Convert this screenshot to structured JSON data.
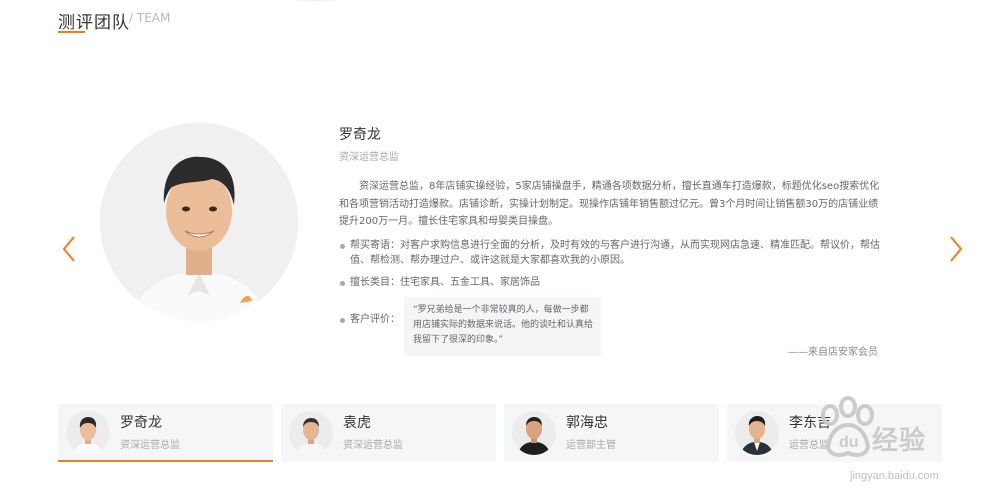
{
  "section": {
    "title": "测评团队",
    "subtitle": "/ TEAM"
  },
  "profile": {
    "name": "罗奇龙",
    "role": "资深运营总监",
    "description": "资深运营总监，8年店铺实操经验，5家店铺操盘手，精通各项数据分析，擅长直通车打造爆款，标题优化seo搜索优化和各项营销活动打造爆款。店铺诊断，实操计划制定。现操作店铺年销售额过亿元。曾3个月时间让销售额30万的店铺业绩提升200万一月。擅长住宅家具和母婴类目操盘。",
    "bullets": {
      "help": "帮买寄语：对客户求购信息进行全面的分析，及时有效的与客户进行沟通，从而实现网店急速、精准匹配。帮议价，帮估值、帮检测、帮办理过户、或许这就是大家都喜欢我的小原因。",
      "category": "擅长类目：住宅家具、五金工具、家居饰品",
      "review_label": "客户评价："
    },
    "quote": "“罗兄弟给是一个非常较真的人，每做一步都用店铺实际的数据来说话。他的谈吐和认真给我留下了很深的印象。”",
    "quote_source": "——来自店安家会员"
  },
  "team": [
    {
      "name": "罗奇龙",
      "role": "资深运营总监",
      "active": true
    },
    {
      "name": "袁虎",
      "role": "资深运营总监",
      "active": false
    },
    {
      "name": "郭海忠",
      "role": "运营部主管",
      "active": false
    },
    {
      "name": "李东吉",
      "role": "运营总监",
      "active": false
    }
  ],
  "watermark": {
    "text": "经验",
    "url": "jingyan.baidu.com"
  },
  "colors": {
    "accent": "#f07c1e",
    "card_bg": "#f5f6f8",
    "quote_bg": "#f4f5f7",
    "muted_text": "#a8a8a8"
  },
  "icons": {
    "prev": "chevron-left-icon",
    "next": "chevron-right-icon",
    "watermark": "baidu-paw-icon"
  }
}
